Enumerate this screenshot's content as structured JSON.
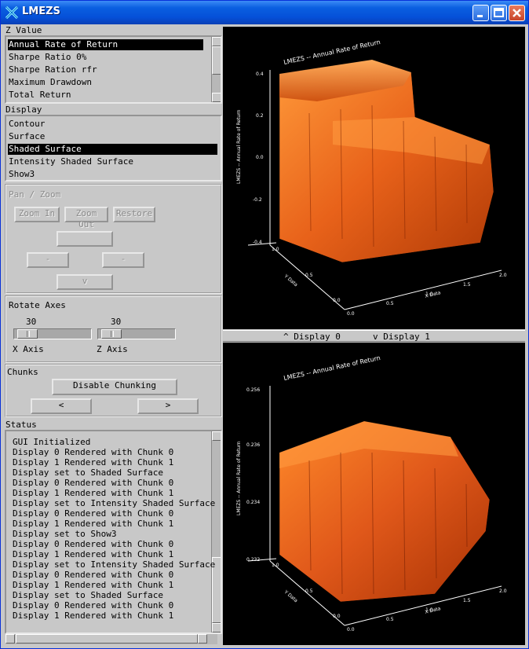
{
  "window": {
    "title": "LMEZS"
  },
  "zvalue": {
    "label": "Z Value",
    "items": [
      "Annual Rate of Return",
      "Sharpe Ratio 0%",
      "Sharpe Ration rfr",
      "Maximum Drawdown",
      "Total Return"
    ],
    "selected": 0
  },
  "display": {
    "label": "Display",
    "items": [
      "Contour",
      "Surface",
      "Shaded Surface",
      "Intensity Shaded Surface",
      "Show3"
    ],
    "selected": 2
  },
  "panzoom": {
    "label": "Pan / Zoom",
    "zoom_in": "Zoom In",
    "zoom_out": "Zoom Out",
    "restore": "Restore",
    "left": "-",
    "right": "-",
    "down": "v"
  },
  "rotate": {
    "label": "Rotate Axes",
    "x_value": "30",
    "x_label": "X Axis",
    "z_value": "30",
    "z_label": "Z Axis"
  },
  "chunks": {
    "label": "Chunks",
    "disable": "Disable Chunking",
    "prev": "<",
    "next": ">"
  },
  "status": {
    "label": "Status",
    "lines": [
      "GUI Initialized",
      "Display 0 Rendered with Chunk 0",
      "Display 1 Rendered with Chunk 1",
      "Display set to Shaded Surface",
      "Display 0 Rendered with Chunk 0",
      "Display 1 Rendered with Chunk 1",
      "Display set to Intensity Shaded Surface",
      "Display 0 Rendered with Chunk 0",
      "Display 1 Rendered with Chunk 1",
      "Display set to Show3",
      "Display 0 Rendered with Chunk 0",
      "Display 1 Rendered with Chunk 1",
      "Display set to Intensity Shaded Surface",
      "Display 0 Rendered with Chunk 0",
      "Display 1 Rendered with Chunk 1",
      "Display set to Shaded Surface",
      "Display 0 Rendered with Chunk 0",
      "Display 1 Rendered with Chunk 1"
    ]
  },
  "divider": {
    "up": "^ Display 0",
    "down": "v Display 1"
  },
  "plot0": {
    "title": "LMEZS -- Annual Rate of Return",
    "zlabel": "LMEZS -- Annual Rate of Return",
    "zticks": [
      "0.4",
      "0.2",
      "0.0",
      "-0.2",
      "-0.4"
    ],
    "xaxis_label": "X Data",
    "yaxis_label": "Y Data",
    "xticks": [
      "0.0",
      "0.5",
      "1.0",
      "1.5",
      "2.0"
    ],
    "yticks": [
      "0.0",
      "0.5",
      "1.0"
    ]
  },
  "plot1": {
    "title": "LMEZS -- Annual Rate of Return",
    "zlabel": "LMEZS -- Annual Rate of Return",
    "zticks": [
      "0.256",
      "0.236",
      "0.234",
      "0.232"
    ],
    "xaxis_label": "X Data",
    "yaxis_label": "Y Data",
    "xticks": [
      "0.0",
      "0.5",
      "1.0",
      "1.5",
      "2.0"
    ],
    "yticks": [
      "0.0",
      "0.5",
      "1.0"
    ]
  },
  "colors": {
    "surface_light": "#ff8a2a",
    "surface_dark": "#b83a00",
    "selection": "#000000",
    "titlebar": "#0a5fe0"
  }
}
